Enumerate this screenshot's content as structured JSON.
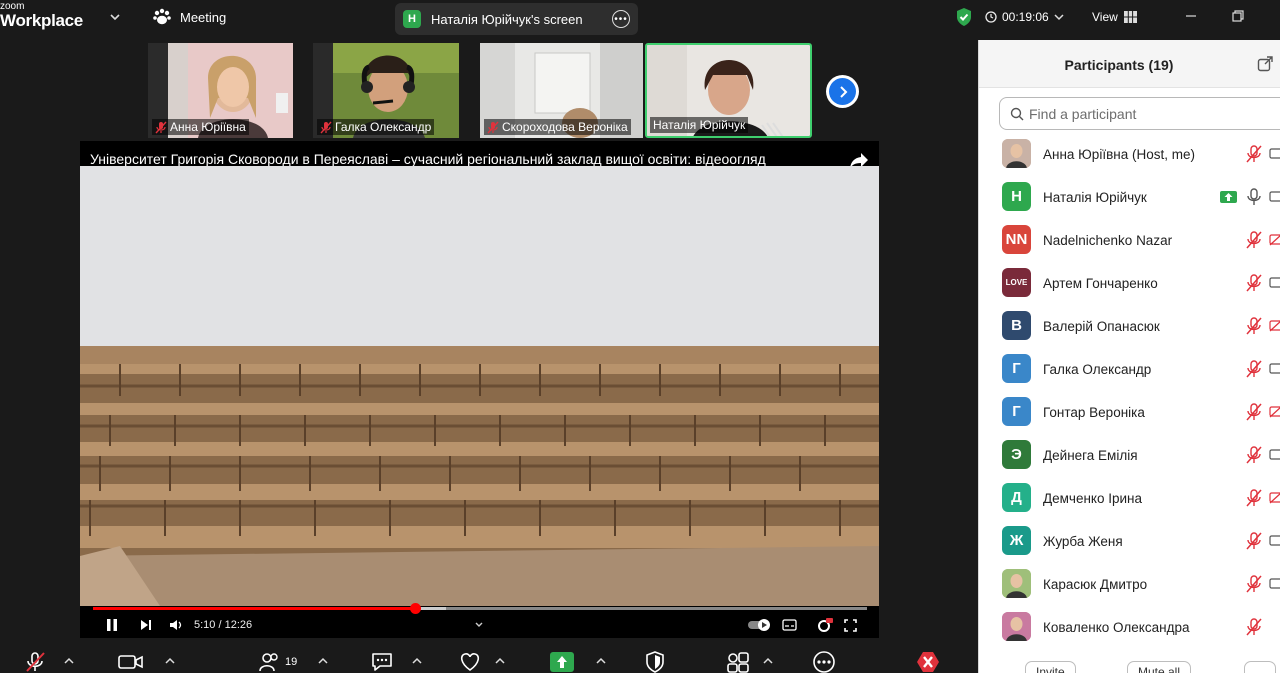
{
  "app": {
    "brand_top": "zoom",
    "brand_bottom": "Workplace",
    "meeting_label": "Meeting",
    "share_badge": "H",
    "share_title": "Наталія Юрійчук's screen",
    "timer": "00:19:06",
    "view_label": "View"
  },
  "thumbnails": [
    {
      "name": "Анна Юріївна",
      "muted": true
    },
    {
      "name": "Галка Олександр",
      "muted": true
    },
    {
      "name": "Скороходова Вероніка",
      "muted": true
    },
    {
      "name": "Наталія Юрійчук",
      "muted": false,
      "active": true
    }
  ],
  "video": {
    "title": "Університет Григорія Сковороди в Переяславі – сучасний регіональний заклад вищої освіти: відеоогляд",
    "time": "5:10 / 12:26",
    "progress": 0.416,
    "buffered": 0.456
  },
  "toolbar": {
    "participants_count": "19"
  },
  "panel": {
    "title": "Participants (19)",
    "search_placeholder": "Find a participant",
    "participants": [
      {
        "name": "Анна Юріївна (Host, me)",
        "avatar_text": "",
        "avatar_color": "#c9b2a6",
        "photo": true,
        "mic": "muted",
        "video": "off"
      },
      {
        "name": "Наталія Юрійчук",
        "avatar_text": "H",
        "avatar_color": "#2ea84e",
        "mic": "on",
        "video": "off",
        "sharing": true
      },
      {
        "name": "Nadelnichenko Nazar",
        "avatar_text": "NN",
        "avatar_color": "#d9453b",
        "mic": "muted",
        "video": "muted"
      },
      {
        "name": "Артем Гончаренко",
        "avatar_text": "LOVE",
        "avatar_color": "#7a2a3a",
        "mic": "muted",
        "video": "off"
      },
      {
        "name": "Валерій Опанасюк",
        "avatar_text": "B",
        "avatar_color": "#2f4a6e",
        "mic": "muted",
        "video": "muted"
      },
      {
        "name": "Галка Олександр",
        "avatar_text": "Г",
        "avatar_color": "#3a87c9",
        "mic": "muted",
        "video": "off"
      },
      {
        "name": "Гонтар Вероніка",
        "avatar_text": "Г",
        "avatar_color": "#3a87c9",
        "mic": "muted",
        "video": "muted"
      },
      {
        "name": "Дейнега Емілія",
        "avatar_text": "Э",
        "avatar_color": "#2f7a3a",
        "mic": "muted",
        "video": "off"
      },
      {
        "name": "Демченко Ірина",
        "avatar_text": "Д",
        "avatar_color": "#24b08a",
        "mic": "muted",
        "video": "muted"
      },
      {
        "name": "Журба Женя",
        "avatar_text": "Ж",
        "avatar_color": "#1a9a8a",
        "mic": "muted",
        "video": "off"
      },
      {
        "name": "Карасюк Дмитро",
        "avatar_text": "",
        "avatar_color": "#9fbf7a",
        "photo": true,
        "mic": "muted",
        "video": "off"
      },
      {
        "name": "Коваленко Олександра",
        "avatar_text": "",
        "avatar_color": "#c97aa0",
        "photo": true,
        "mic": "muted",
        "video": "none"
      }
    ],
    "invite_label": "Invite",
    "mute_all_label": "Mute all",
    "more_label": "..."
  },
  "colors": {
    "accent_green": "#2ea84e",
    "muted_red": "#e0323c",
    "zoom_blue": "#1a73e8"
  }
}
